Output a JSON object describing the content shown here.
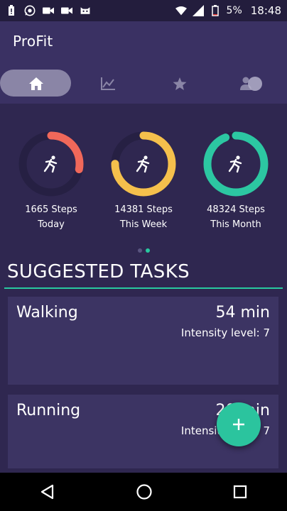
{
  "status_bar": {
    "battery": "5%",
    "time": "18:48",
    "icons": [
      "battery-alert-icon",
      "whatsapp-icon",
      "video-icon",
      "video-icon",
      "cat-icon",
      "wifi-icon",
      "signal-icon",
      "battery-icon"
    ]
  },
  "app": {
    "title": "ProFit"
  },
  "tabs": [
    {
      "name": "home",
      "icon": "home-icon",
      "active": true
    },
    {
      "name": "stats",
      "icon": "chart-icon",
      "active": false
    },
    {
      "name": "favorites",
      "icon": "star-icon",
      "active": false
    },
    {
      "name": "profile",
      "icon": "people-icon",
      "active": false
    }
  ],
  "step_rings": [
    {
      "line1": "1665 Steps",
      "line2": "Today",
      "progress": 0.28,
      "color": "#f0685a",
      "icon": "run-icon"
    },
    {
      "line1": "14381 Steps",
      "line2": "This Week",
      "progress": 0.75,
      "color": "#f5c04c",
      "icon": "run-icon"
    },
    {
      "line1": "48324 Steps",
      "line2": "This Month",
      "progress": 0.94,
      "color": "#2cc7a2",
      "icon": "run-icon"
    }
  ],
  "pager": {
    "pages": 2,
    "active_index": 1
  },
  "suggested": {
    "heading": "SUGGESTED TASKS",
    "tasks": [
      {
        "name": "Walking",
        "duration": "54 min",
        "intensity": "Intensity level: 7"
      },
      {
        "name": "Running",
        "duration": "20 min",
        "intensity": "Intensity level: 7"
      }
    ]
  },
  "fab": {
    "icon": "plus-icon",
    "color": "#2bc49e"
  },
  "navbar": {
    "icons": [
      "back-icon",
      "home-circle-icon",
      "recents-icon"
    ]
  }
}
